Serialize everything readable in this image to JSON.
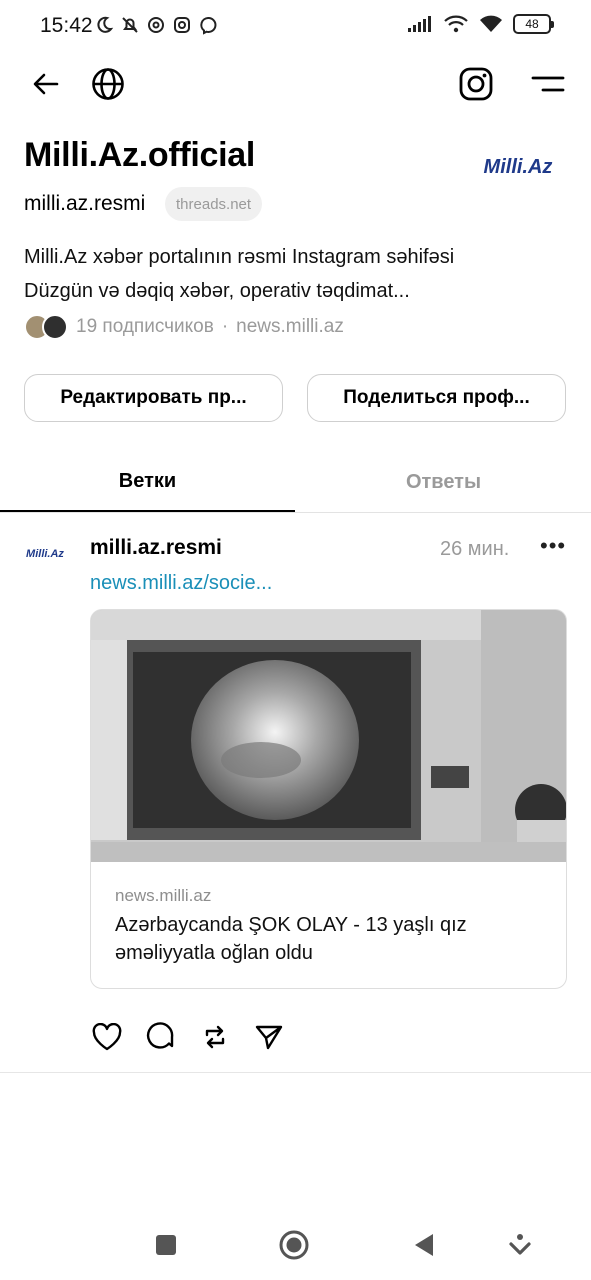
{
  "status": {
    "time": "15:42",
    "battery": "48"
  },
  "header": {
    "back_icon": "arrow-left-icon",
    "globe_icon": "globe-icon",
    "instagram_icon": "instagram-icon",
    "menu_icon": "menu-icon"
  },
  "profile": {
    "name": "Milli.Az.official",
    "logo_text": "Milli.Az",
    "username": "milli.az.resmi",
    "threads_chip": "threads.net",
    "bio_line1": "Milli.Az xəbər portalının rəsmi Instagram səhifəsi",
    "bio_line2": "Düzgün və dəqiq xəbər, operativ təqdimat...",
    "followers": "19 подписчиков",
    "separator": "·",
    "website": "news.milli.az"
  },
  "buttons": {
    "edit": "Редактировать пр...",
    "share": "Поделиться проф..."
  },
  "tabs": {
    "threads": "Ветки",
    "replies": "Ответы"
  },
  "post": {
    "avatar_text": "Milli.Az",
    "username": "milli.az.resmi",
    "time": "26 мин.",
    "more": "•••",
    "link": "news.milli.az/socie...",
    "card_domain": "news.milli.az",
    "card_title": "Azərbaycanda ŞOK OLAY - 13 yaşlı qız əməliyyatla oğlan oldu"
  },
  "colors": {
    "link": "#1a8fb8",
    "logo": "#1f3a8a",
    "muted": "#9a9a9a"
  }
}
